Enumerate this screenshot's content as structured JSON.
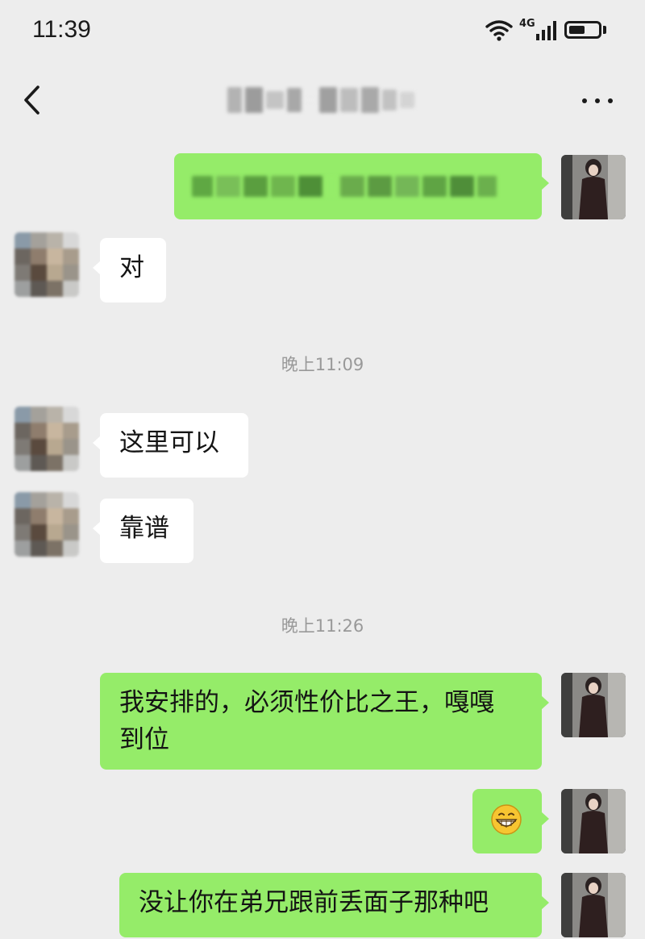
{
  "status": {
    "time": "11:39",
    "network": "4G",
    "signal_bars": 4,
    "battery_level": 0.55
  },
  "nav": {
    "back_icon": "chevron-left-icon",
    "more_icon": "more-dots-icon"
  },
  "messages": [
    {
      "side": "out",
      "text": "",
      "redacted": true
    },
    {
      "side": "in",
      "text": "对"
    },
    {
      "timestamp": "晚上11:09"
    },
    {
      "side": "in",
      "text": "这里可以"
    },
    {
      "side": "in",
      "text": "靠谱"
    },
    {
      "timestamp": "晚上11:26"
    },
    {
      "side": "out",
      "text": "我安排的，必须性价比之王，嘎嘎到位",
      "line1": "我安排的，必须性价比之王，嘎嘎",
      "line2": "到位"
    },
    {
      "side": "out",
      "emoji": "grinning-face-icon"
    },
    {
      "side": "out",
      "text": "没让你在弟兄跟前丢面子那种吧"
    }
  ],
  "colors": {
    "background": "#ededed",
    "bubble_out": "#95ec69",
    "bubble_in": "#ffffff",
    "timestamp": "#999999"
  }
}
